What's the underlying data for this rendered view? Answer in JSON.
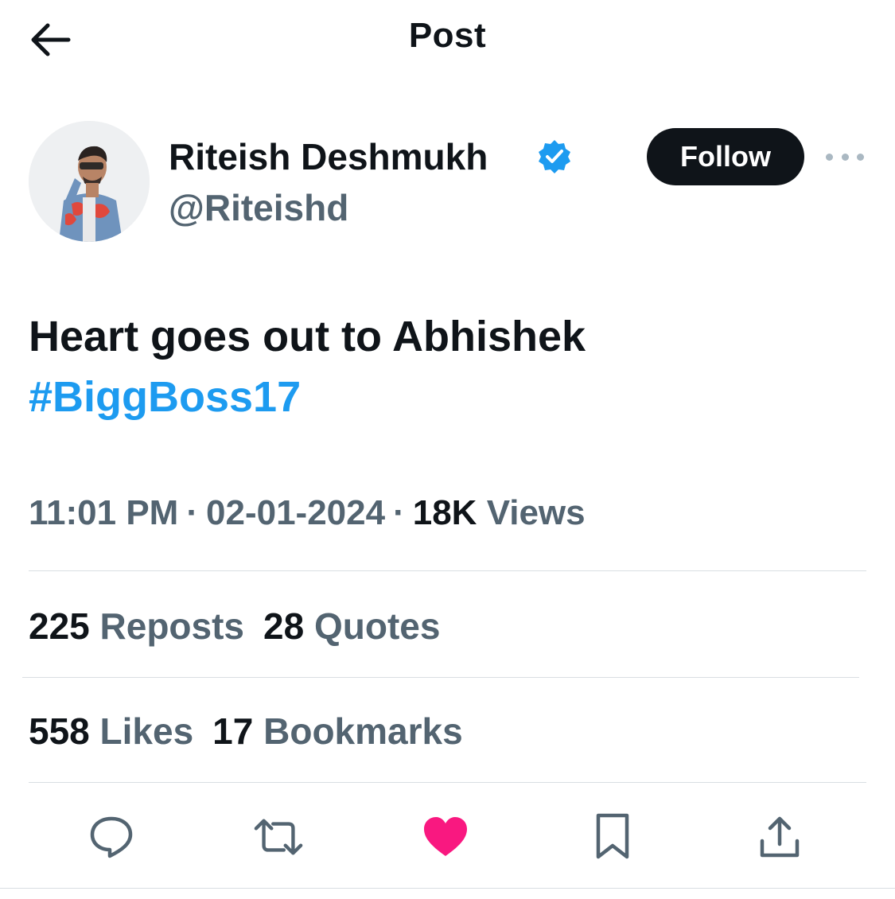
{
  "header": {
    "title": "Post"
  },
  "author": {
    "name": "Riteish Deshmukh",
    "handle": "@Riteishd",
    "verified": true,
    "follow_label": "Follow"
  },
  "post": {
    "text": "Heart goes out to Abhishek",
    "hashtag": "#BiggBoss17"
  },
  "meta": {
    "time": "11:01 PM",
    "date": "02-01-2024",
    "views_count": "18K",
    "views_label": "Views"
  },
  "stats": {
    "reposts_count": "225",
    "reposts_label": "Reposts",
    "quotes_count": "28",
    "quotes_label": "Quotes",
    "likes_count": "558",
    "likes_label": "Likes",
    "bookmarks_count": "17",
    "bookmarks_label": "Bookmarks"
  },
  "actions": [
    "reply-icon",
    "repost-icon",
    "like-icon",
    "bookmark-icon",
    "share-icon"
  ],
  "colors": {
    "text_primary": "#0f1419",
    "text_secondary": "#536471",
    "link": "#1d9bf0",
    "verified": "#1d9bf0",
    "like_active": "#f91880",
    "follow_bg": "#0f1419"
  }
}
